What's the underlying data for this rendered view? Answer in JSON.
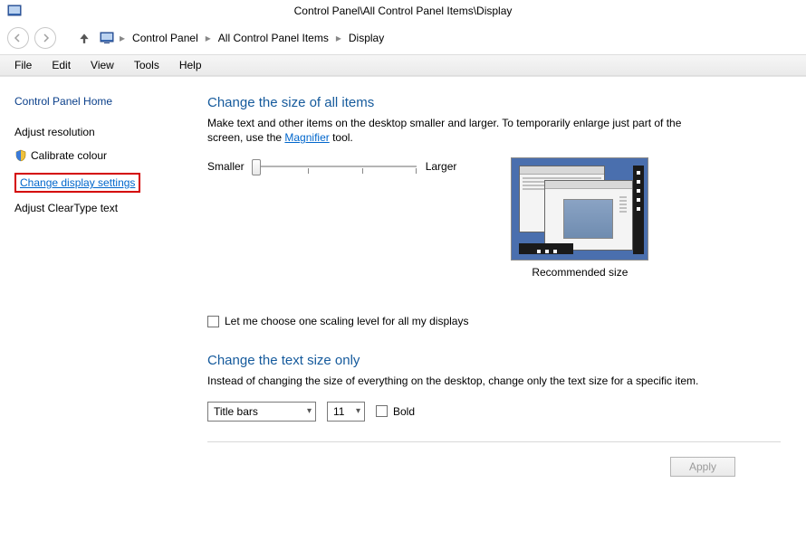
{
  "window": {
    "title": "Control Panel\\All Control Panel Items\\Display"
  },
  "breadcrumb": {
    "items": [
      "Control Panel",
      "All Control Panel Items",
      "Display"
    ]
  },
  "menu": {
    "items": [
      "File",
      "Edit",
      "View",
      "Tools",
      "Help"
    ]
  },
  "sidebar": {
    "home": "Control Panel Home",
    "adjust_resolution": "Adjust resolution",
    "calibrate_colour": "Calibrate colour",
    "change_display_settings": "Change display settings",
    "adjust_cleartype": "Adjust ClearType text"
  },
  "main": {
    "section1_title": "Change the size of all items",
    "section1_desc_pre": "Make text and other items on the desktop smaller and larger. To temporarily enlarge just part of the screen, use the ",
    "section1_link": "Magnifier",
    "section1_desc_post": " tool.",
    "slider_min": "Smaller",
    "slider_max": "Larger",
    "preview_caption": "Recommended size",
    "scaling_checkbox": "Let me choose one scaling level for all my displays",
    "section2_title": "Change the text size only",
    "section2_desc": "Instead of changing the size of everything on the desktop, change only the text size for a specific item.",
    "select_item": "Title bars",
    "select_size": "11",
    "bold_label": "Bold",
    "apply": "Apply"
  }
}
